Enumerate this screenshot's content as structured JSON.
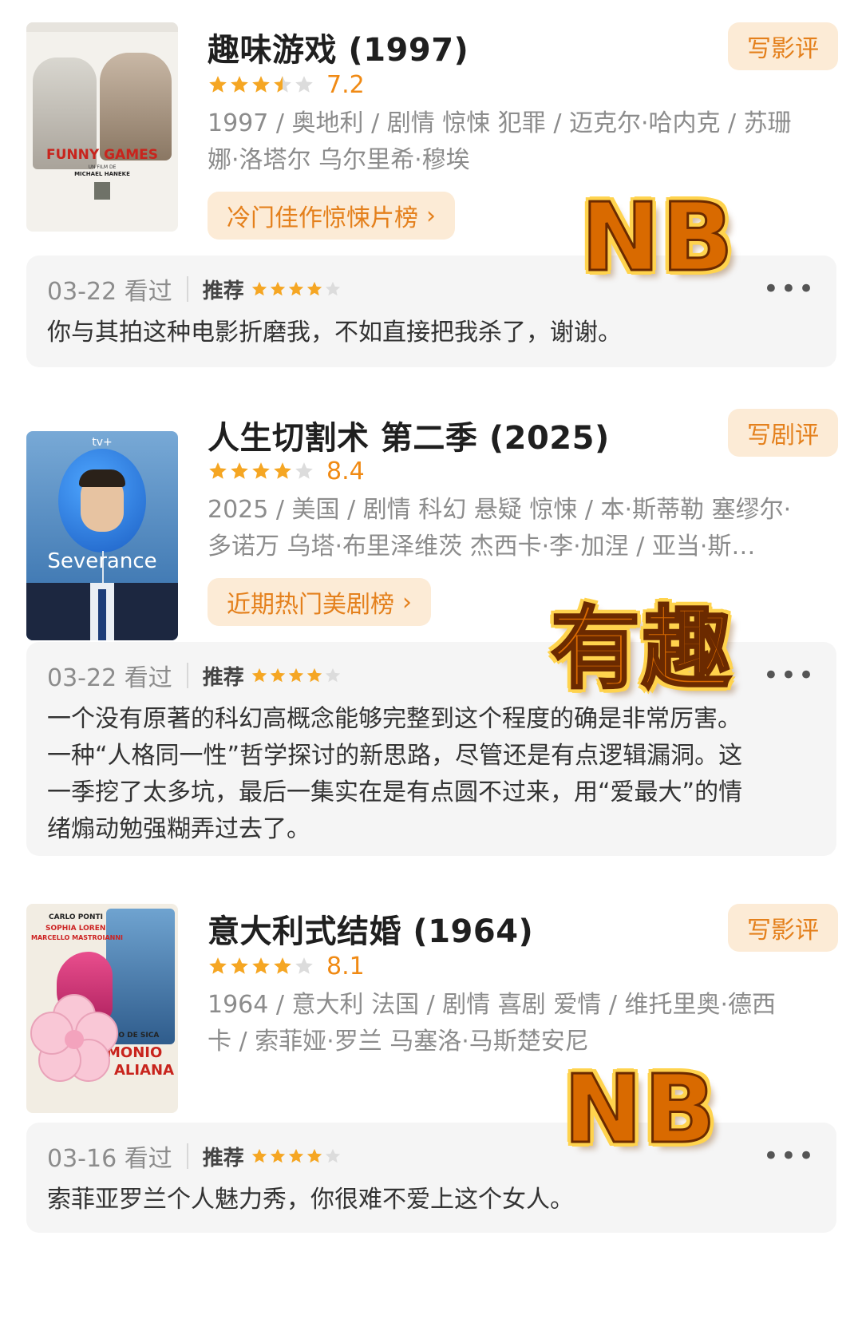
{
  "entries": [
    {
      "title": "趣味游戏 (1997)",
      "review_button": "写影评",
      "stars_filled": 3.5,
      "score": "7.2",
      "meta_line1": "1997 / 奥地利 / 剧情 惊悚 犯罪 / 迈克尔·哈内克 / 苏珊",
      "meta_line2": "娜·洛塔尔 乌尔里希·穆埃",
      "list_button": "冷门佳作惊悚片榜",
      "poster_title": "FUNNY GAMES",
      "poster_subtitle": "UN FILM DE",
      "poster_director": "MICHAEL HANEKE",
      "comment": {
        "date": "03-22 看过",
        "rec_label": "推荐",
        "rec_stars": 4,
        "text_lines": [
          "你与其拍这种电影折磨我，不如直接把我杀了，谢谢。"
        ]
      },
      "sticker": "NB"
    },
    {
      "title": "人生切割术 第二季 (2025)",
      "review_button": "写剧评",
      "stars_filled": 4,
      "score": "8.4",
      "meta_line1": "2025 / 美国 / 剧情 科幻 悬疑 惊悚 / 本·斯蒂勒 塞缪尔·",
      "meta_line2": "多诺万 乌塔·布里泽维茨 杰西卡·李·加涅 / 亚当·斯…",
      "list_button": "近期热门美剧榜",
      "poster_brand": "tv+",
      "poster_title": "Severance",
      "comment": {
        "date": "03-22 看过",
        "rec_label": "推荐",
        "rec_stars": 4,
        "text_lines": [
          "一个没有原著的科幻高概念能够完整到这个程度的确是非常厉害。",
          "一种“人格同一性”哲学探讨的新思路，尽管还是有点逻辑漏洞。这",
          "一季挖了太多坑，最后一集实在是有点圆不过来，用“爱最大”的情",
          "绪煽动勉强糊弄过去了。"
        ]
      },
      "sticker": "有趣"
    },
    {
      "title": "意大利式结婚 (1964)",
      "review_button": "写影评",
      "stars_filled": 4,
      "score": "8.1",
      "meta_line1": "1964 / 意大利 法国 / 剧情 喜剧 爱情 / 维托里奥·德西",
      "meta_line2": "卡 / 索菲娅·罗兰 马塞洛·马斯楚安尼",
      "poster_credits": [
        "CARLO PONTI",
        "SOPHIA LOREN",
        "MARCELLO MASTROIANNI"
      ],
      "poster_title1": "IO DE SICA",
      "poster_title2": "MONIO",
      "poster_title3": "ALIANA",
      "comment": {
        "date": "03-16 看过",
        "rec_label": "推荐",
        "rec_stars": 4,
        "text_lines": [
          "索菲亚罗兰个人魅力秀，你很难不爱上这个女人。"
        ]
      },
      "sticker": "NB"
    }
  ],
  "more_icon": "more-dots-icon",
  "colors": {
    "accent": "#e4801c",
    "star": "#f5a623",
    "star_empty": "#dcdcdc",
    "button_bg": "#fcebd6"
  }
}
